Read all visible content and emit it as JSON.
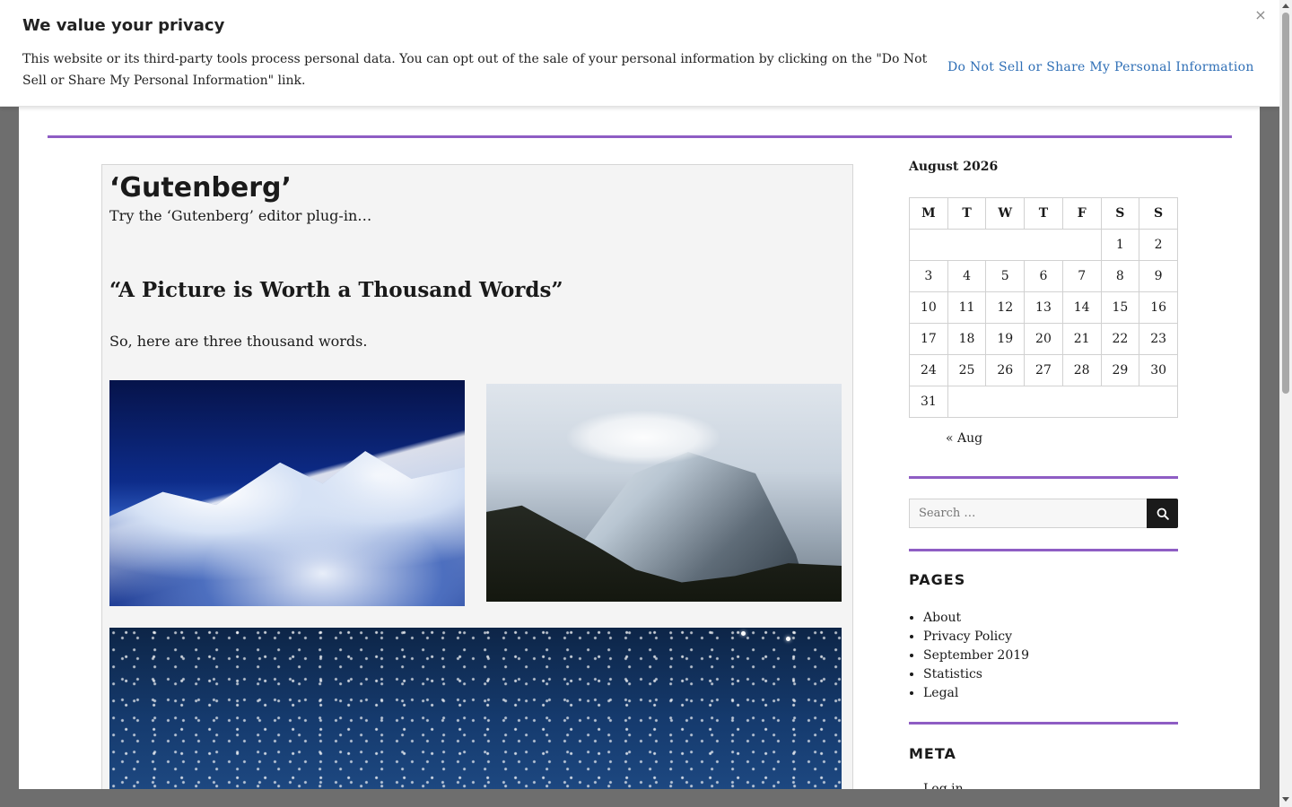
{
  "banner": {
    "title": "We value your privacy",
    "text": "This website or its third-party tools process personal data. You can opt out of the sale of your personal information by clicking on the \"Do Not Sell or Share My Personal Information\" link.",
    "link": "Do Not Sell or Share My Personal Information",
    "close": "×"
  },
  "post": {
    "title": "‘Gutenberg’",
    "subtitle": "Try the ‘Gutenberg’ editor plug-in…",
    "heading": "“A Picture is Worth a Thousand Words”",
    "paragraph": "So, here are three thousand words."
  },
  "calendar": {
    "caption": "August 2026",
    "weekdays": [
      "M",
      "T",
      "W",
      "T",
      "F",
      "S",
      "S"
    ],
    "weeks": [
      [
        "",
        "",
        "",
        "",
        "",
        "1",
        "2"
      ],
      [
        "3",
        "4",
        "5",
        "6",
        "7",
        "8",
        "9"
      ],
      [
        "10",
        "11",
        "12",
        "13",
        "14",
        "15",
        "16"
      ],
      [
        "17",
        "18",
        "19",
        "20",
        "21",
        "22",
        "23"
      ],
      [
        "24",
        "25",
        "26",
        "27",
        "28",
        "29",
        "30"
      ],
      [
        "31",
        "",
        "",
        "",
        "",
        "",
        ""
      ]
    ],
    "prev": "« Aug"
  },
  "search": {
    "placeholder": "Search …",
    "icon": "search-icon"
  },
  "pages": {
    "title": "PAGES",
    "items": [
      "About",
      "Privacy Policy",
      "September 2019",
      "Statistics",
      "Legal"
    ]
  },
  "meta": {
    "title": "META",
    "first_item": "Log in"
  },
  "colors": {
    "accent": "#8e5dc4",
    "link": "#2f6fb6"
  }
}
